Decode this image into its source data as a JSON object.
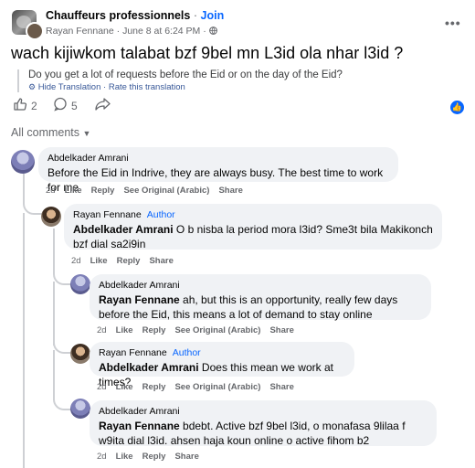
{
  "post": {
    "group_name": "Chauffeurs professionnels",
    "separator": "·",
    "join_label": "Join",
    "author_name": "Rayan Fennane",
    "date": "June 8 at 6:24 PM",
    "audience_icon": "globe-icon",
    "more_icon": "•••",
    "title": "wach kijiwkom talabat bzf 9bel mn L3id ola nhar l3id ?",
    "translation": "Do you get a lot of requests before the Eid or on the day of the Eid?",
    "hide_translation": "Hide Translation",
    "rate_translation": "Rate this translation",
    "likes_count": "2",
    "comments_count": "5"
  },
  "comments_header": {
    "label": "All comments"
  },
  "comments": [
    {
      "author": "Abdelkader Amrani",
      "role": "",
      "mention": "",
      "text": "Before the Eid in Indrive, they are always busy. The best time to work for me",
      "time": "2d",
      "like": "Like",
      "reply": "Reply",
      "see_original": "See Original (Arabic)",
      "share": "Share"
    },
    {
      "author": "Rayan Fennane",
      "role": "Author",
      "mention": "Abdelkader Amrani",
      "text": " O b nisba la period mora l3id? Sme3t bila Makikonch bzf dial sa2i9in",
      "time": "2d",
      "like": "Like",
      "reply": "Reply",
      "share": "Share"
    },
    {
      "author": "Abdelkader Amrani",
      "role": "",
      "mention": "Rayan Fennane",
      "text": " ah, but this is an opportunity, really few days before the Eid, this means a lot of demand to stay online",
      "time": "2d",
      "like": "Like",
      "reply": "Reply",
      "see_original": "See Original (Arabic)",
      "share": "Share"
    },
    {
      "author": "Rayan Fennane",
      "role": "Author",
      "mention": "Abdelkader Amrani",
      "text": " Does this mean we work at times?",
      "time": "2d",
      "like": "Like",
      "reply": "Reply",
      "see_original": "See Original (Arabic)",
      "share": "Share"
    },
    {
      "author": "Abdelkader Amrani",
      "role": "",
      "mention": "Rayan Fennane",
      "text": " bdebt. Active bzf 9bel l3id, o monafasa 9lilaa f w9ita dial l3id. ahsen haja koun online o active fihom b2",
      "time": "2d",
      "like": "Like",
      "reply": "Reply",
      "share": "Share"
    }
  ],
  "colors": {
    "link_blue": "#0866ff",
    "bubble_bg": "#f0f2f5",
    "meta_gray": "#65676b"
  }
}
